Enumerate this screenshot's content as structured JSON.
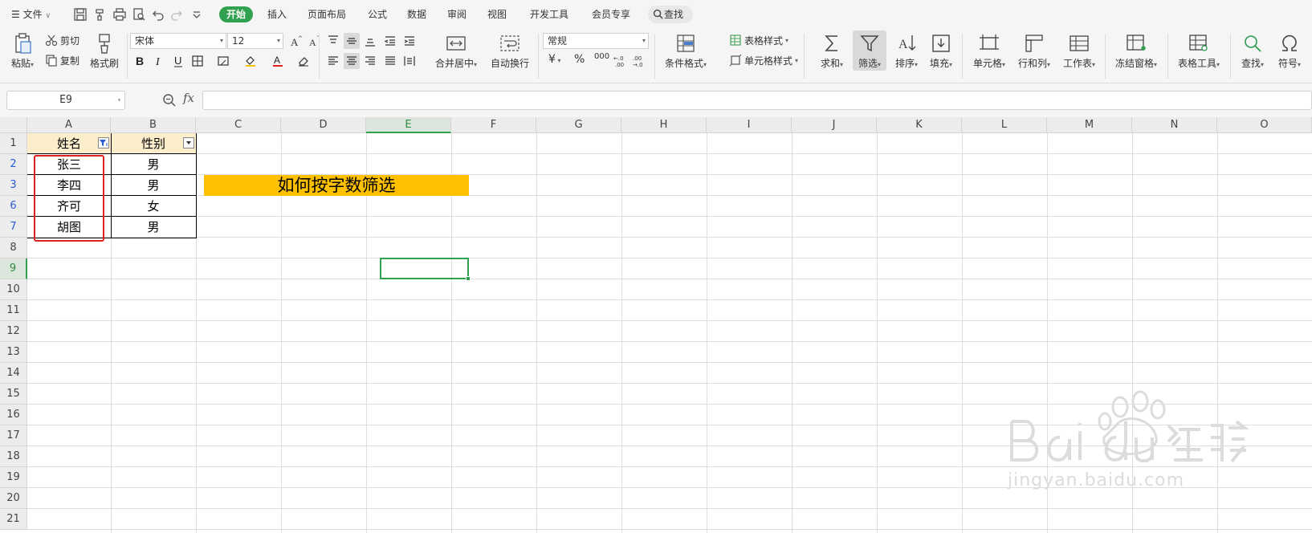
{
  "menubar": {
    "file_label": "文件",
    "tabs": [
      "开始",
      "插入",
      "页面布局",
      "公式",
      "数据",
      "审阅",
      "视图",
      "开发工具",
      "会员专享"
    ],
    "active_tab": "开始",
    "search_label": "查找"
  },
  "ribbon": {
    "paste": "粘贴",
    "cut": "剪切",
    "copy": "复制",
    "format_painter": "格式刷",
    "font_name": "宋体",
    "font_size": "12",
    "merge_center": "合并居中",
    "wrap_text": "自动换行",
    "number_format": "常规",
    "currency_symbol": "¥",
    "percent_symbol": "%",
    "thousands_symbol": "000",
    "conditional_format": "条件格式",
    "table_style": "表格样式",
    "cell_style": "单元格样式",
    "sum": "求和",
    "filter": "筛选",
    "sort": "排序",
    "fill": "填充",
    "cells": "单元格",
    "rows_cols": "行和列",
    "worksheet": "工作表",
    "freeze": "冻结窗格",
    "table_tools": "表格工具",
    "find": "查找",
    "symbol": "符号"
  },
  "formula_bar": {
    "name_box": "E9",
    "fx": "fx",
    "formula": ""
  },
  "sheet": {
    "columns": [
      "A",
      "B",
      "C",
      "D",
      "E",
      "F",
      "G",
      "H",
      "I",
      "J",
      "K",
      "L",
      "M",
      "N",
      "O"
    ],
    "selected_column": "E",
    "row_numbers": [
      "1",
      "2",
      "3",
      "6",
      "7",
      "8",
      "9",
      "10",
      "11",
      "12",
      "13",
      "14",
      "15",
      "16",
      "17",
      "18",
      "19",
      "20",
      "21"
    ],
    "selected_row": "9",
    "header_name": "姓名",
    "header_gender": "性别",
    "rows": [
      {
        "name": "张三",
        "gender": "男"
      },
      {
        "name": "李四",
        "gender": "男"
      },
      {
        "name": "齐可",
        "gender": "女"
      },
      {
        "name": "胡图",
        "gender": "男"
      }
    ],
    "banner_text": "如何按字数筛选",
    "banner_color": "#ffc000",
    "header_fill": "#fdeecb",
    "accent": "#30a14e"
  },
  "watermark": {
    "text": "jingyan.baidu.com"
  }
}
